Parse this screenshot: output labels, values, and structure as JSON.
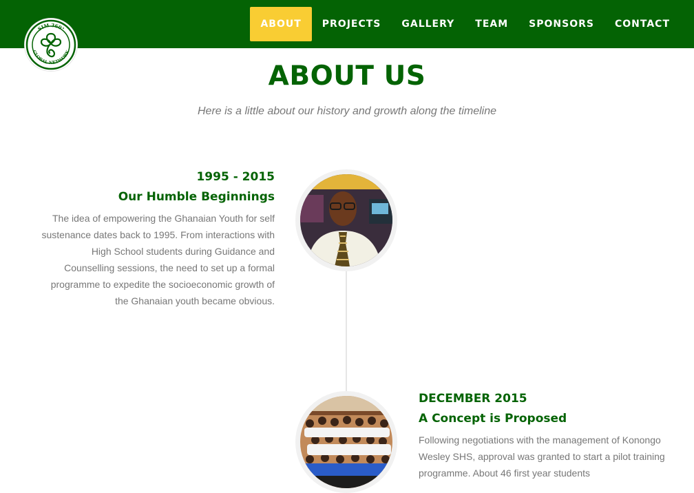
{
  "nav": {
    "items": [
      {
        "label": "ABOUT",
        "active": true
      },
      {
        "label": "PROJECTS",
        "active": false
      },
      {
        "label": "GALLERY",
        "active": false
      },
      {
        "label": "TEAM",
        "active": false
      },
      {
        "label": "SPONSORS",
        "active": false
      },
      {
        "label": "CONTACT",
        "active": false
      }
    ]
  },
  "logo": {
    "top_text": "SIM 360°",
    "bottom_text": "GLOBAL NETWORK"
  },
  "about": {
    "title": "ABOUT US",
    "subtitle": "Here is a little about our history and growth along the timeline"
  },
  "timeline": [
    {
      "date": "1995 - 2015",
      "heading": "Our Humble Beginnings",
      "body": "The idea of empowering the Ghanaian Youth for self sustenance dates back to 1995. From interactions with High School students during Guidance and Counselling sessions, the need to set up a formal programme to expedite the socioeconomic growth of the Ghanaian youth became obvious."
    },
    {
      "date": "DECEMBER 2015",
      "heading": "A Concept is Proposed",
      "body": "Following negotiations with the management of Konongo Wesley SHS, approval was granted to start a pilot training programme. About 46 first year students"
    }
  ],
  "colors": {
    "brand_green": "#046304",
    "accent_yellow": "#f9cd33",
    "body_text": "#777777"
  },
  "icons": {
    "logo": "celtic-knot-logo"
  }
}
